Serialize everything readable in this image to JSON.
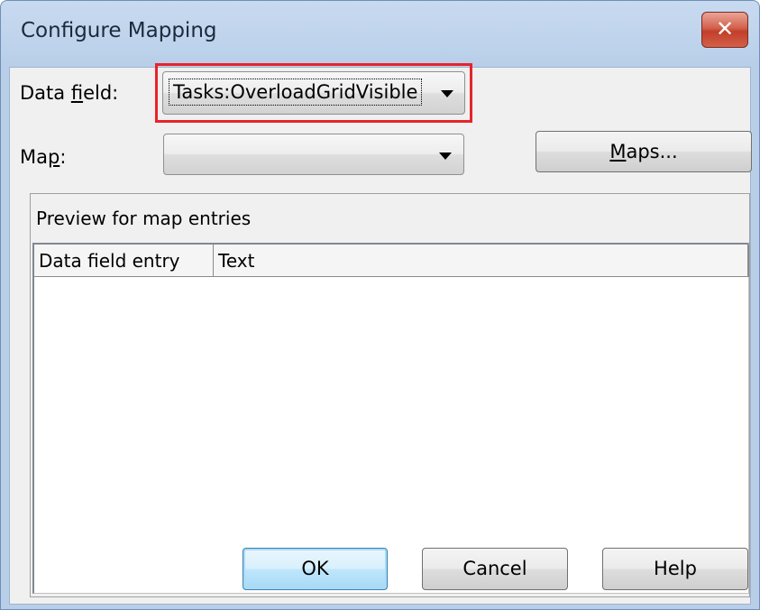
{
  "window": {
    "title": "Configure Mapping",
    "close_glyph": "✕"
  },
  "data_field": {
    "label_prefix": "Data ",
    "label_accel": "f",
    "label_suffix": "ield:",
    "value": "Tasks:OverloadGridVisible"
  },
  "map": {
    "label_prefix": "Ma",
    "label_accel": "p",
    "label_suffix": ":",
    "value": ""
  },
  "maps_button": {
    "accel": "M",
    "rest": "aps..."
  },
  "preview": {
    "title": "Preview for map entries",
    "columns": [
      "Data field entry",
      "Text"
    ],
    "rows": []
  },
  "buttons": {
    "ok": "OK",
    "cancel": "Cancel",
    "help": "Help"
  },
  "colors": {
    "highlight": "#e8232a",
    "close_button": "#c23e2a"
  },
  "icons": {
    "close": "close-icon",
    "dropdown": "chevron-down-icon"
  }
}
